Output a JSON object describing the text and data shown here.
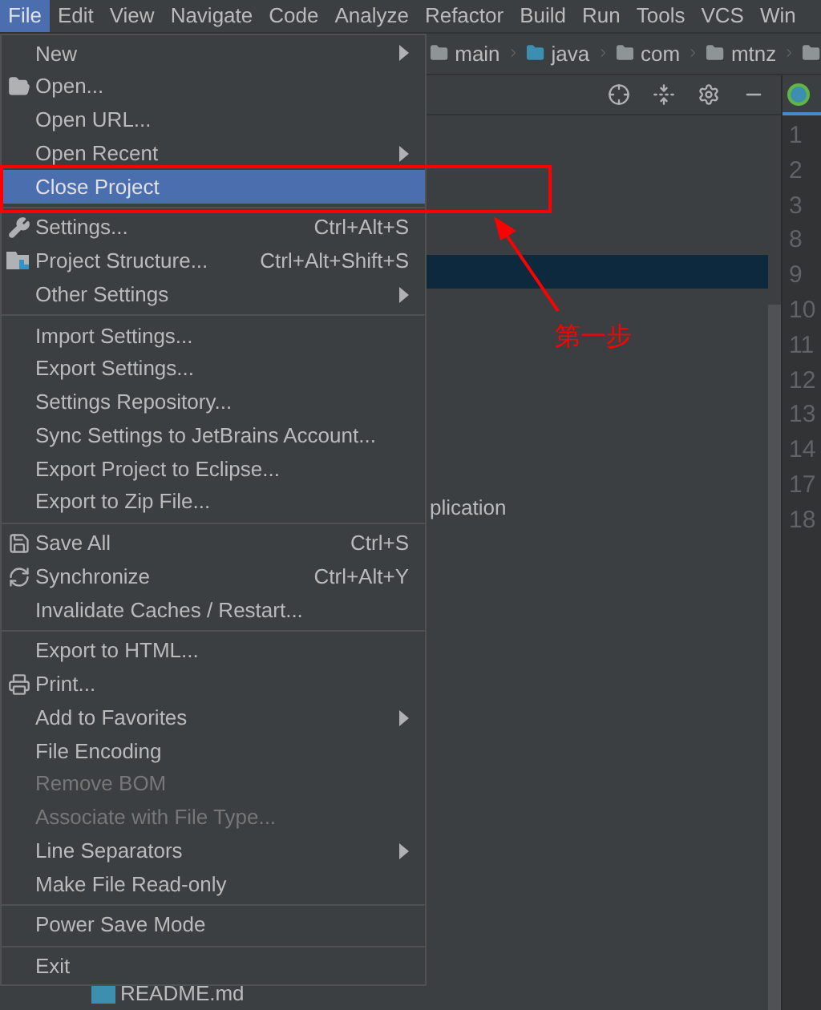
{
  "menubar": [
    {
      "label": "File",
      "selected": true
    },
    {
      "label": "Edit",
      "selected": false
    },
    {
      "label": "View",
      "selected": false
    },
    {
      "label": "Navigate",
      "selected": false
    },
    {
      "label": "Code",
      "selected": false
    },
    {
      "label": "Analyze",
      "selected": false
    },
    {
      "label": "Refactor",
      "selected": false
    },
    {
      "label": "Build",
      "selected": false
    },
    {
      "label": "Run",
      "selected": false
    },
    {
      "label": "Tools",
      "selected": false
    },
    {
      "label": "VCS",
      "selected": false
    },
    {
      "label": "Win",
      "selected": false
    }
  ],
  "breadcrumbs": [
    "main",
    "java",
    "com",
    "mtnz"
  ],
  "file_menu": {
    "groups": [
      [
        {
          "label": "New",
          "submenu": true,
          "disabled": false,
          "selected": false
        },
        {
          "label": "Open...",
          "submenu": false,
          "disabled": false,
          "selected": false
        },
        {
          "label": "Open URL...",
          "submenu": false,
          "disabled": false,
          "selected": false
        },
        {
          "label": "Open Recent",
          "submenu": true,
          "disabled": false,
          "selected": false
        },
        {
          "label": "Close Project",
          "submenu": false,
          "disabled": false,
          "selected": true
        }
      ],
      [
        {
          "label": "Settings...",
          "shortcut": "Ctrl+Alt+S",
          "submenu": false,
          "disabled": false,
          "selected": false
        },
        {
          "label": "Project Structure...",
          "shortcut": "Ctrl+Alt+Shift+S",
          "submenu": false,
          "disabled": false,
          "selected": false
        },
        {
          "label": "Other Settings",
          "submenu": true,
          "disabled": false,
          "selected": false
        }
      ],
      [
        {
          "label": "Import Settings...",
          "submenu": false,
          "disabled": false,
          "selected": false
        },
        {
          "label": "Export Settings...",
          "submenu": false,
          "disabled": false,
          "selected": false
        },
        {
          "label": "Settings Repository...",
          "submenu": false,
          "disabled": false,
          "selected": false
        },
        {
          "label": "Sync Settings to JetBrains Account...",
          "submenu": false,
          "disabled": false,
          "selected": false
        },
        {
          "label": "Export Project to Eclipse...",
          "submenu": false,
          "disabled": false,
          "selected": false
        },
        {
          "label": "Export to Zip File...",
          "submenu": false,
          "disabled": false,
          "selected": false
        }
      ],
      [
        {
          "label": "Save All",
          "shortcut": "Ctrl+S",
          "submenu": false,
          "disabled": false,
          "selected": false
        },
        {
          "label": "Synchronize",
          "shortcut": "Ctrl+Alt+Y",
          "submenu": false,
          "disabled": false,
          "selected": false
        },
        {
          "label": "Invalidate Caches / Restart...",
          "submenu": false,
          "disabled": false,
          "selected": false
        }
      ],
      [
        {
          "label": "Export to HTML...",
          "submenu": false,
          "disabled": false,
          "selected": false
        },
        {
          "label": "Print...",
          "submenu": false,
          "disabled": false,
          "selected": false
        },
        {
          "label": "Add to Favorites",
          "submenu": true,
          "disabled": false,
          "selected": false
        },
        {
          "label": "File Encoding",
          "submenu": false,
          "disabled": false,
          "selected": false
        },
        {
          "label": "Remove BOM",
          "submenu": false,
          "disabled": true,
          "selected": false
        },
        {
          "label": "Associate with File Type...",
          "submenu": false,
          "disabled": true,
          "selected": false
        },
        {
          "label": "Line Separators",
          "submenu": true,
          "disabled": false,
          "selected": false
        },
        {
          "label": "Make File Read-only",
          "submenu": false,
          "disabled": false,
          "selected": false
        }
      ],
      [
        {
          "label": "Power Save Mode",
          "submenu": false,
          "disabled": false,
          "selected": false
        }
      ],
      [
        {
          "label": "Exit",
          "submenu": false,
          "disabled": false,
          "selected": false
        }
      ]
    ]
  },
  "project_tree": {
    "rows": [
      {
        "selected": true
      },
      {
        "label": "plication",
        "selected": false
      },
      {
        "label": "README.md",
        "selected": false
      }
    ]
  },
  "line_numbers": [
    "1",
    "2",
    "3",
    "8",
    "9",
    "10",
    "11",
    "12",
    "13",
    "14",
    "17",
    "18"
  ],
  "annotation": {
    "label": "第一步"
  }
}
